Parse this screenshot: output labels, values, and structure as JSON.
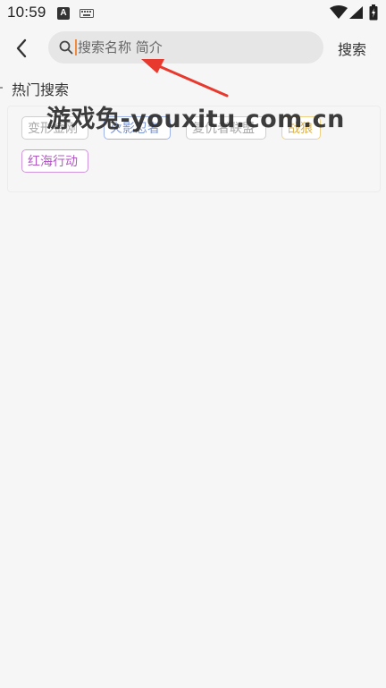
{
  "status_bar": {
    "time": "10:59",
    "notification_letter": "A",
    "icons": [
      "notification-a-icon",
      "keyboard-icon",
      "wifi-icon",
      "signal-icon",
      "battery-icon"
    ]
  },
  "header": {
    "back_icon": "chevron-left-icon",
    "search": {
      "placeholder": "搜索名称 简介",
      "value": ""
    },
    "submit_label": "搜索"
  },
  "hot_search": {
    "title": "热门搜索",
    "tags": [
      {
        "label": "变形金刚",
        "color": "#a9a9a9"
      },
      {
        "label": "火影忍者",
        "color": "#7a96d8"
      },
      {
        "label": "复仇者联盟",
        "color": "#a9a9a9"
      },
      {
        "label": "战狼",
        "color": "#e0b242"
      },
      {
        "label": "红海行动",
        "color": "#b458c8"
      }
    ]
  },
  "watermark": "游戏兔-youxitu.com.cn",
  "colors": {
    "background": "#f6f6f6",
    "search_box": "#e6e6e6",
    "annotation_arrow": "#e8392e"
  }
}
